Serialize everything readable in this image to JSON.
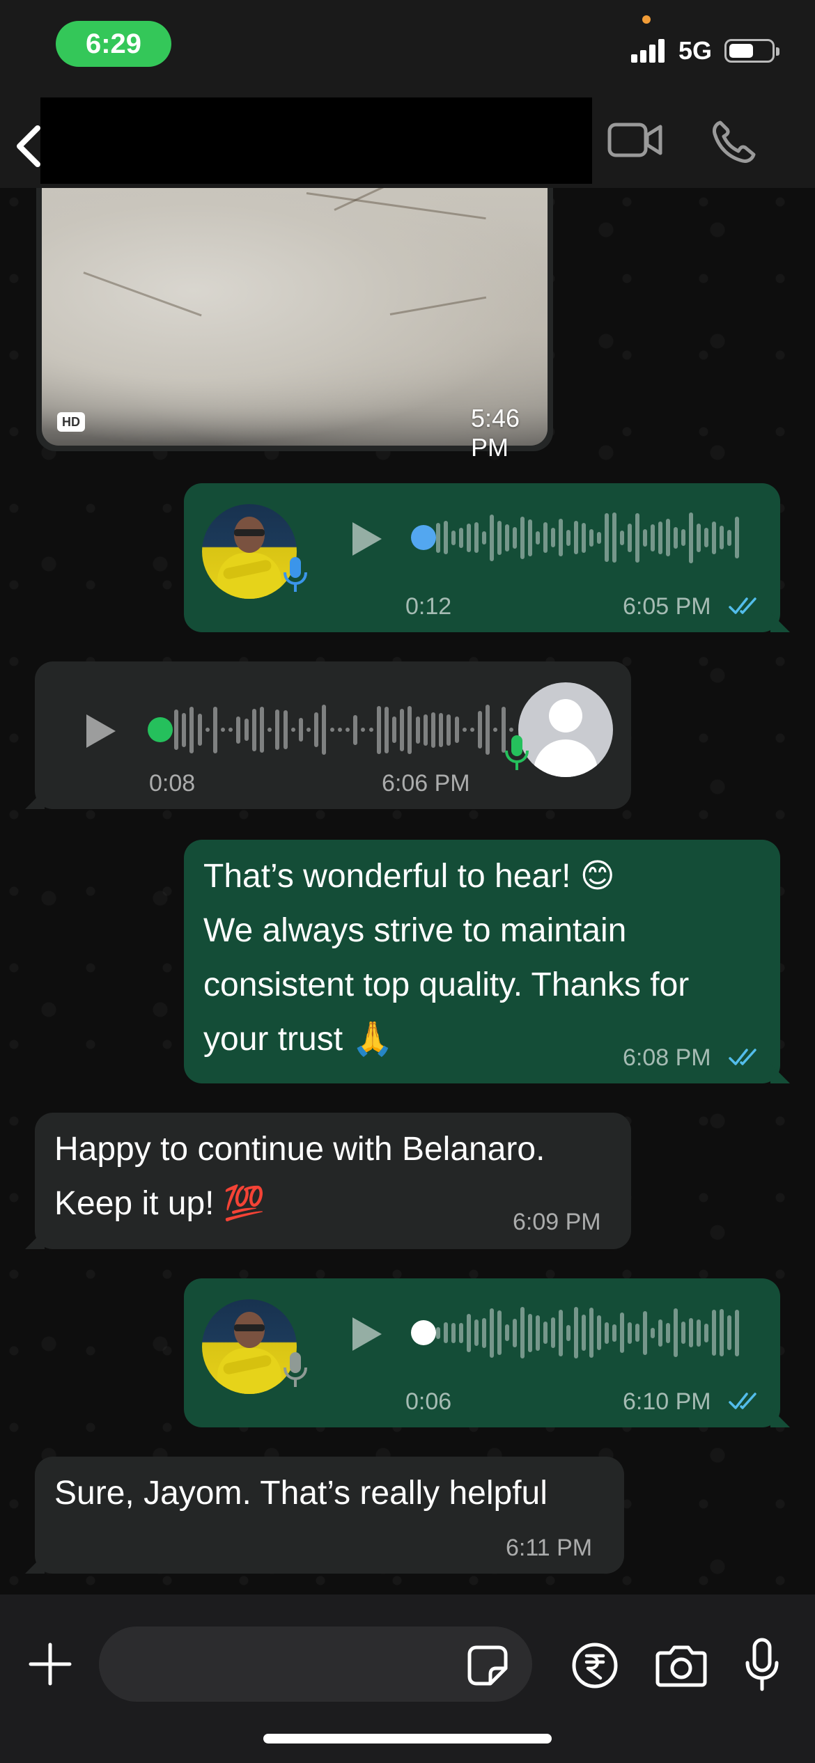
{
  "status_bar": {
    "time": "6:29",
    "network": "5G"
  },
  "header": {
    "back_icon": "chevron-left-icon",
    "video_icon": "video-camera-icon",
    "call_icon": "phone-icon",
    "name_redacted": true
  },
  "colors": {
    "outgoing_bubble": "#144d37",
    "incoming_bubble": "#242626",
    "accent_green": "#25d366",
    "read_ticks": "#53bdeb",
    "time_pill": "#34c759"
  },
  "messages": [
    {
      "type": "image",
      "direction": "incoming",
      "badge": "HD",
      "time": "5:46 PM"
    },
    {
      "type": "voice",
      "direction": "outgoing",
      "duration": "0:12",
      "time": "6:05 PM",
      "status": "read",
      "played": false
    },
    {
      "type": "voice",
      "direction": "incoming",
      "duration": "0:08",
      "time": "6:06 PM"
    },
    {
      "type": "text",
      "direction": "outgoing",
      "lines": [
        "That’s wonderful to hear! 😊",
        "We always strive to maintain",
        "consistent top quality. Thanks for",
        "your trust 🙏"
      ],
      "time": "6:08 PM",
      "status": "read"
    },
    {
      "type": "text",
      "direction": "incoming",
      "lines": [
        "Happy to continue with Belanaro.",
        "Keep it up! 💯"
      ],
      "time": "6:09 PM"
    },
    {
      "type": "voice",
      "direction": "outgoing",
      "duration": "0:06",
      "time": "6:10 PM",
      "status": "read",
      "played": true
    },
    {
      "type": "text",
      "direction": "incoming",
      "lines": [
        "Sure, Jayom. That’s really helpful"
      ],
      "time": "6:11 PM"
    }
  ],
  "input_bar": {
    "placeholder": "",
    "value": "",
    "icons": [
      "plus-icon",
      "sticker-icon",
      "rupee-payment-icon",
      "camera-icon",
      "microphone-icon"
    ]
  }
}
